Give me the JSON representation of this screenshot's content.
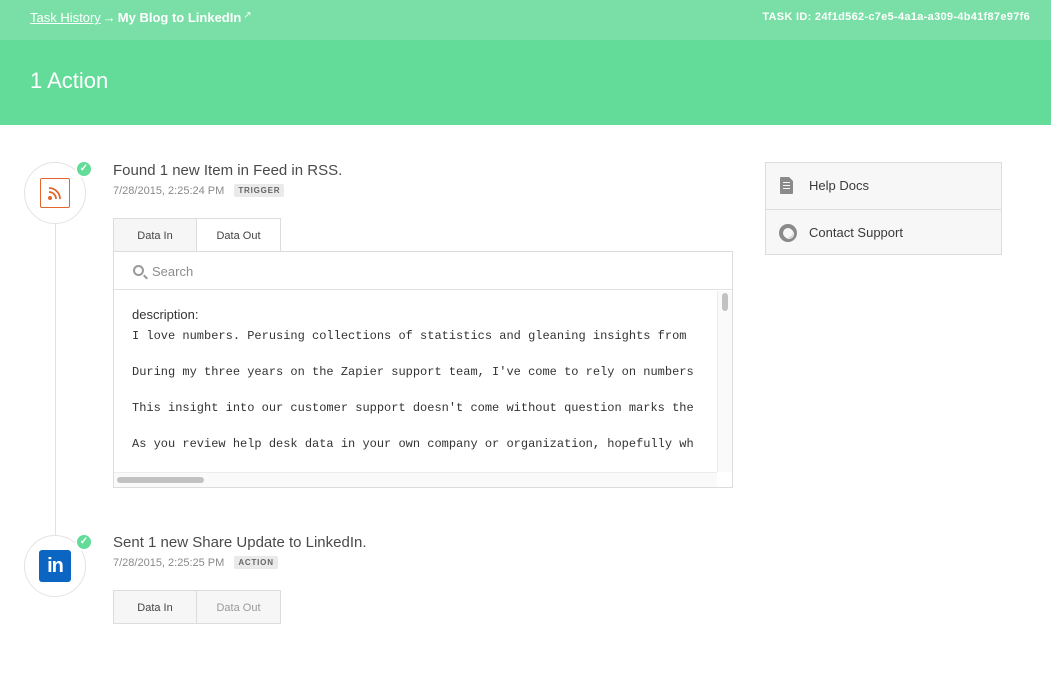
{
  "topbar": {
    "breadcrumb_link": "Task History",
    "breadcrumb_arrow": "→",
    "breadcrumb_current": "My Blog to LinkedIn",
    "external_icon": "external-link-icon",
    "task_id_label": "TASK ID: 24f1d562-c7e5-4a1a-a309-4b41f87e97f6"
  },
  "header": {
    "title": "1 Action"
  },
  "colors": {
    "topbar": "#79dfa6",
    "header": "#63db99",
    "check": "#63db99",
    "rss": "#e2652b",
    "linkedin": "#0a66c2"
  },
  "steps": [
    {
      "icon": "rss-feed-icon",
      "title": "Found 1 new Item in Feed in RSS.",
      "timestamp": "7/28/2015, 2:25:24 PM",
      "badge": "TRIGGER",
      "tabs": [
        {
          "label": "Data In",
          "active": false
        },
        {
          "label": "Data Out",
          "active": true
        }
      ],
      "search_placeholder": "Search",
      "field_key": "description:",
      "paragraphs": [
        "I love numbers. Perusing collections of statistics and gleaning insights from",
        "During my three years on the Zapier support team, I've come to rely on numbers",
        "This insight into our customer support doesn't come without question marks the",
        "As you review help desk data in your own company or organization, hopefully wh"
      ]
    },
    {
      "icon": "linkedin-icon",
      "logo_text": "in",
      "title": "Sent 1 new Share Update to LinkedIn.",
      "timestamp": "7/28/2015, 2:25:25 PM",
      "badge": "ACTION",
      "tabs": [
        {
          "label": "Data In",
          "active": false
        },
        {
          "label": "Data Out",
          "active": false
        }
      ]
    }
  ],
  "sidebar": {
    "items": [
      {
        "label": "Help Docs",
        "icon": "document-icon"
      },
      {
        "label": "Contact Support",
        "icon": "lifebuoy-icon"
      }
    ]
  }
}
